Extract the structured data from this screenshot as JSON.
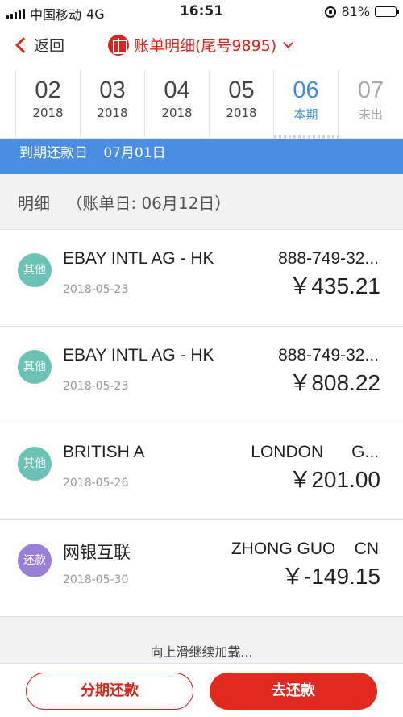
{
  "status_bar": {
    "carrier": "中国移动",
    "network": "4G",
    "time": "16:51",
    "battery_percent": "81%",
    "battery_level": 0.81
  },
  "nav": {
    "back_label": "返回",
    "title": "账单明细(尾号9895)"
  },
  "month_tabs": [
    {
      "month": "02",
      "year": "2018",
      "state": "normal"
    },
    {
      "month": "03",
      "year": "2018",
      "state": "normal"
    },
    {
      "month": "04",
      "year": "2018",
      "state": "normal"
    },
    {
      "month": "05",
      "year": "2018",
      "state": "normal"
    },
    {
      "month": "06",
      "year": "本期",
      "state": "active"
    },
    {
      "month": "07",
      "year": "未出",
      "state": "future"
    }
  ],
  "due_banner": {
    "label": "到期还款日",
    "date": "07月01日"
  },
  "section": {
    "title": "明细",
    "statement_date": "（账单日: 06月12日）"
  },
  "transactions": [
    {
      "badge": "其他",
      "badge_color": "#6cc2b4",
      "merchant": "EBAY INTL AG - HK",
      "location": "888-749-32...",
      "date": "2018-05-23",
      "amount": "￥435.21"
    },
    {
      "badge": "其他",
      "badge_color": "#6cc2b4",
      "merchant": "EBAY INTL AG - HK",
      "location": "888-749-32...",
      "date": "2018-05-23",
      "amount": "￥808.22"
    },
    {
      "badge": "其他",
      "badge_color": "#6cc2b4",
      "merchant": "BRITISH A",
      "location": "LONDON      G...",
      "date": "2018-05-26",
      "amount": "￥201.00"
    },
    {
      "badge": "还款",
      "badge_color": "#9a7fd6",
      "merchant": "网银互联",
      "location": "ZHONG GUO    CN",
      "date": "2018-05-30",
      "amount": "￥-149.15"
    }
  ],
  "load_more": "向上滑继续加载...",
  "bottom_bar": {
    "installment_label": "分期还款",
    "repay_label": "去还款"
  },
  "colors": {
    "brand_red": "#d9261c",
    "banner_blue": "#4a8de3",
    "active_tab_blue": "#3d8de0"
  }
}
